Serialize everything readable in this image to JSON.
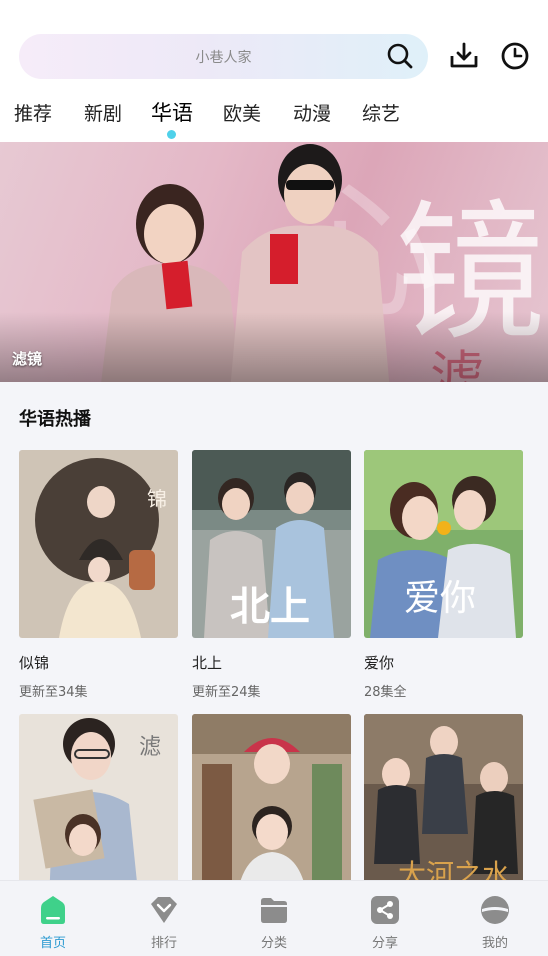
{
  "search": {
    "placeholder": "小巷人家"
  },
  "tabs": [
    {
      "label": "推荐"
    },
    {
      "label": "新剧"
    },
    {
      "label": "华语",
      "active": true
    },
    {
      "label": "欧美"
    },
    {
      "label": "动漫"
    },
    {
      "label": "综艺"
    }
  ],
  "banner": {
    "title": "滤镜"
  },
  "section": {
    "title": "华语热播",
    "cards": [
      {
        "title": "似锦",
        "sub": "更新至34集"
      },
      {
        "title": "北上",
        "sub": "更新至24集"
      },
      {
        "title": "爱你",
        "sub": "28集全"
      },
      {
        "title": "",
        "sub": ""
      },
      {
        "title": "",
        "sub": ""
      },
      {
        "title": "",
        "sub": ""
      }
    ]
  },
  "nav": [
    {
      "label": "首页",
      "icon": "home-icon",
      "active": true
    },
    {
      "label": "排行",
      "icon": "rank-icon"
    },
    {
      "label": "分类",
      "icon": "folder-icon"
    },
    {
      "label": "分享",
      "icon": "share-icon"
    },
    {
      "label": "我的",
      "icon": "profile-icon"
    }
  ],
  "colors": {
    "accent": "#2c9ad1",
    "tab_indicator": "#4fd1ea",
    "home_icon": "#3fd18a"
  }
}
